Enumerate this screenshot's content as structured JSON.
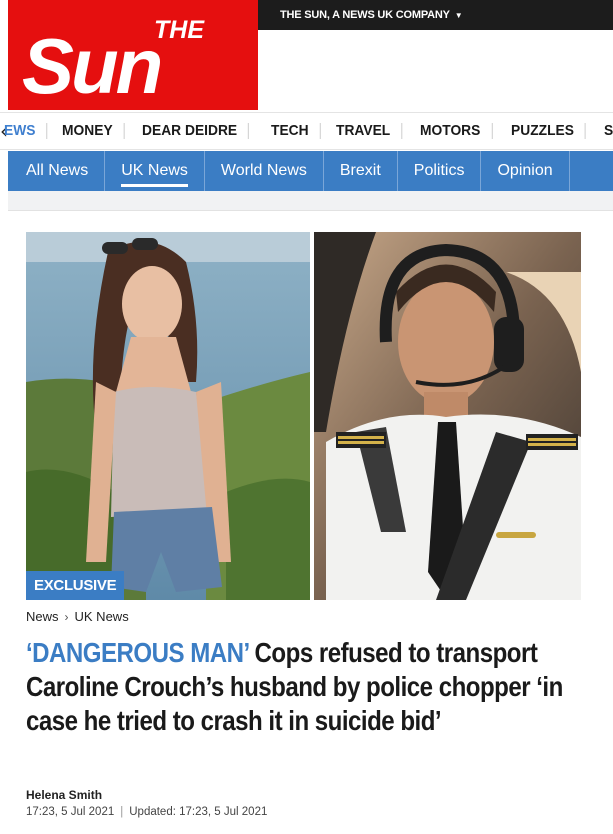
{
  "header": {
    "company_text": "THE SUN, A NEWS UK COMPANY",
    "logo": {
      "the": "THE",
      "sun": "Sun"
    }
  },
  "section_nav": {
    "back_icon": "chevron-left-icon",
    "items": [
      "EWS",
      "MONEY",
      "DEAR DEIDRE",
      "TECH",
      "TRAVEL",
      "MOTORS",
      "PUZZLES",
      "SU"
    ]
  },
  "sub_nav": {
    "items": [
      "All News",
      "UK News",
      "World News",
      "Brexit",
      "Politics",
      "Opinion"
    ],
    "active": "UK News"
  },
  "article": {
    "badge": "EXCLUSIVE",
    "breadcrumb": [
      "News",
      "UK News"
    ],
    "kicker": "‘DANGEROUS MAN’",
    "headline": "Cops refused to transport Caroline Crouch’s husband by police chopper ‘in case he tried to crash it in suicide bid’",
    "author": "Helena Smith",
    "published": "17:23, 5 Jul 2021",
    "updated": "Updated: 17:23, 5 Jul 2021"
  },
  "colors": {
    "brand_red": "#e50f0f",
    "accent_blue": "#3b7dc4",
    "dark_bar": "#1c1c1c"
  }
}
